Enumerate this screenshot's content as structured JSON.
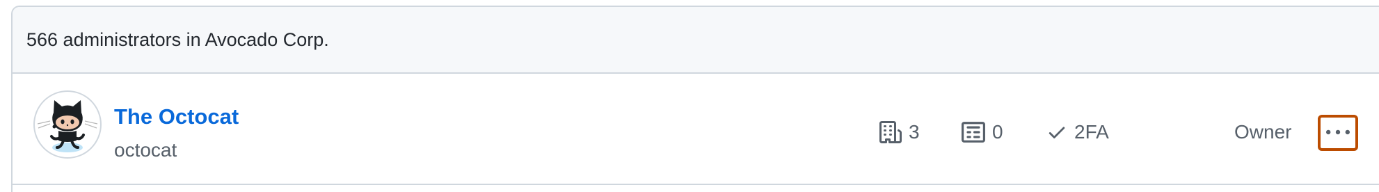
{
  "header": {
    "summary": "566 administrators in Avocado Corp."
  },
  "member": {
    "name": "The Octocat",
    "login": "octocat",
    "stats": {
      "organizations": "3",
      "teams": "0",
      "twofa": "2FA"
    },
    "role": "Owner",
    "icons": {
      "organizations": "organization-icon",
      "teams": "id-badge-icon",
      "twofa": "check-icon",
      "actions": "kebab-horizontal-icon"
    }
  },
  "colors": {
    "link": "#0969da",
    "muted": "#57606a",
    "border": "#d0d7de",
    "header_bg": "#f6f8fa",
    "focus_outline": "#bc4c00"
  }
}
